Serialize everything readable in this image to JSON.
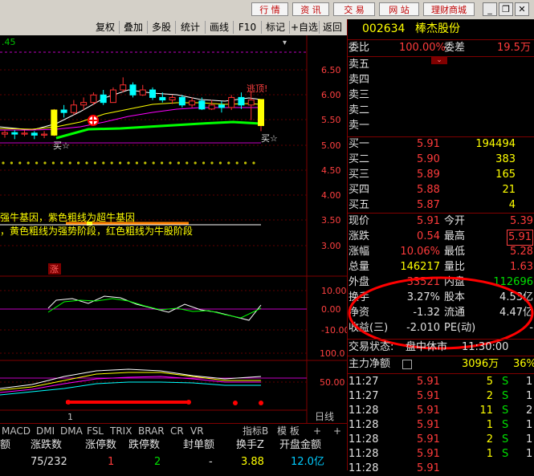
{
  "topbar": {
    "buttons": [
      "行 情",
      "资 讯",
      "交 易",
      "网 站",
      "理财商城"
    ]
  },
  "toolbar": {
    "items": [
      "复权",
      "叠加",
      "多股",
      "统计",
      "画线",
      "F10",
      "标记",
      "+自选",
      "返回"
    ],
    "price_label": ".45"
  },
  "chart": {
    "yaxis_main": [
      "6.50",
      "6.00",
      "5.50",
      "5.00",
      "4.50",
      "4.00",
      "3.50",
      "3.00"
    ],
    "yaxis_ind1": [
      "10.00",
      "0.00",
      "-10.00"
    ],
    "yaxis_ind2": [
      "100.0",
      "50.00"
    ],
    "annotation_top": "逃顶!",
    "buy_labels": [
      "买☆",
      "买☆"
    ],
    "text_line1": "强牛基因，紫色粗线为超牛基因",
    "text_line2": "，黄色粗线为强势阶段，红色粗线为牛股阶段",
    "zhang_badge": "涨",
    "x_label": "1",
    "period_label": "日线"
  },
  "chart_data": {
    "type": "candlestick",
    "ylim": [
      2.8,
      6.8
    ],
    "candles": [
      {
        "o": 5.22,
        "c": 5.25,
        "h": 5.3,
        "l": 5.15
      },
      {
        "o": 5.25,
        "c": 5.22,
        "h": 5.3,
        "l": 5.12
      },
      {
        "o": 5.22,
        "c": 5.24,
        "h": 5.3,
        "l": 5.18
      },
      {
        "o": 5.24,
        "c": 5.2,
        "h": 5.28,
        "l": 5.12
      },
      {
        "o": 5.2,
        "c": 5.22,
        "h": 5.28,
        "l": 5.14
      },
      {
        "o": 5.2,
        "c": 5.7,
        "h": 5.72,
        "l": 5.18
      },
      {
        "o": 5.7,
        "c": 5.65,
        "h": 5.8,
        "l": 5.55
      },
      {
        "o": 5.65,
        "c": 5.8,
        "h": 5.9,
        "l": 5.6
      },
      {
        "o": 5.8,
        "c": 5.85,
        "h": 5.95,
        "l": 5.7
      },
      {
        "o": 5.85,
        "c": 6.0,
        "h": 6.05,
        "l": 5.8
      },
      {
        "o": 6.0,
        "c": 5.85,
        "h": 6.1,
        "l": 5.8
      },
      {
        "o": 5.85,
        "c": 6.1,
        "h": 6.15,
        "l": 5.85
      },
      {
        "o": 6.1,
        "c": 6.2,
        "h": 6.35,
        "l": 6.05
      },
      {
        "o": 6.2,
        "c": 6.0,
        "h": 6.25,
        "l": 5.95
      },
      {
        "o": 6.0,
        "c": 6.1,
        "h": 6.2,
        "l": 5.98
      },
      {
        "o": 6.1,
        "c": 5.95,
        "h": 6.15,
        "l": 5.9
      },
      {
        "o": 5.95,
        "c": 5.9,
        "h": 6.05,
        "l": 5.85
      },
      {
        "o": 5.9,
        "c": 5.95,
        "h": 6.0,
        "l": 5.82
      },
      {
        "o": 5.95,
        "c": 5.8,
        "h": 6.0,
        "l": 5.75
      },
      {
        "o": 5.8,
        "c": 5.88,
        "h": 5.95,
        "l": 5.75
      },
      {
        "o": 5.88,
        "c": 5.72,
        "h": 5.95,
        "l": 5.7
      },
      {
        "o": 5.72,
        "c": 5.8,
        "h": 5.9,
        "l": 5.7
      },
      {
        "o": 5.8,
        "c": 5.75,
        "h": 5.88,
        "l": 5.65
      },
      {
        "o": 5.75,
        "c": 5.95,
        "h": 6.0,
        "l": 5.7
      },
      {
        "o": 5.95,
        "c": 5.8,
        "h": 6.05,
        "l": 5.72
      },
      {
        "o": 5.8,
        "c": 5.9,
        "h": 6.08,
        "l": 5.5
      },
      {
        "o": 5.39,
        "c": 5.91,
        "h": 5.91,
        "l": 5.28
      }
    ]
  },
  "bottom_tabs": [
    "MACD",
    "DMI",
    "DMA",
    "FSL",
    "TRIX",
    "BRAR",
    "CR",
    "VR",
    "指标B",
    "模 板",
    "+",
    "+"
  ],
  "stats": {
    "headers": [
      "额",
      "涨跌数",
      "涨停数",
      "跌停数",
      "封单额",
      "换手Z",
      "开盘金额"
    ],
    "values": [
      "",
      "75/232",
      "1",
      "2",
      "-",
      "3.88",
      "12.0亿"
    ]
  },
  "stock": {
    "code": "002634",
    "name": "棒杰股份",
    "weibi_label": "委比",
    "weibi": "100.00%",
    "weicha_label": "委差",
    "weicha": "19.5万",
    "sells": [
      {
        "label": "卖五"
      },
      {
        "label": "卖四"
      },
      {
        "label": "卖三"
      },
      {
        "label": "卖二"
      },
      {
        "label": "卖一"
      }
    ],
    "buys": [
      {
        "label": "买一",
        "price": "5.91",
        "vol": "194494"
      },
      {
        "label": "买二",
        "price": "5.90",
        "vol": "383"
      },
      {
        "label": "买三",
        "price": "5.89",
        "vol": "165"
      },
      {
        "label": "买四",
        "price": "5.88",
        "vol": "21"
      },
      {
        "label": "买五",
        "price": "5.87",
        "vol": "4"
      }
    ],
    "quote": [
      {
        "l1": "现价",
        "v1": "5.91",
        "l2": "今开",
        "v2": "5.39"
      },
      {
        "l1": "涨跌",
        "v1": "0.54",
        "l2": "最高",
        "v2": "5.91"
      },
      {
        "l1": "涨幅",
        "v1": "10.06%",
        "l2": "最低",
        "v2": "5.28"
      },
      {
        "l1": "总量",
        "v1": "146217",
        "l2": "量比",
        "v2": "1.63"
      },
      {
        "l1": "外盘",
        "v1": "33521",
        "l2": "内盘",
        "v2": "112696"
      },
      {
        "l1": "换手",
        "v1": "3.27%",
        "l2": "股本",
        "v2": "4.53亿"
      },
      {
        "l1": "净资",
        "v1": "-1.32",
        "l2": "流通",
        "v2": "4.47亿"
      },
      {
        "l1": "收益(三)",
        "v1": "-2.010",
        "l2": "PE(动)",
        "v2": "-"
      }
    ],
    "status_label": "交易状态:",
    "status_value": "盘中休市",
    "status_time": "11:30:00",
    "main_flow_label": "主力净额",
    "main_flow_value": "3096万",
    "main_flow_pct": "36%",
    "ticks": [
      {
        "t": "11:27",
        "p": "5.91",
        "v": "5",
        "s": "S",
        "n": "1"
      },
      {
        "t": "11:27",
        "p": "5.91",
        "v": "2",
        "s": "S",
        "n": "1"
      },
      {
        "t": "11:28",
        "p": "5.91",
        "v": "11",
        "s": "S",
        "n": "2"
      },
      {
        "t": "11:28",
        "p": "5.91",
        "v": "1",
        "s": "S",
        "n": "1"
      },
      {
        "t": "11:28",
        "p": "5.91",
        "v": "2",
        "s": "S",
        "n": "1"
      },
      {
        "t": "11:28",
        "p": "5.91",
        "v": "1",
        "s": "S",
        "n": "1"
      },
      {
        "t": "11:28",
        "p": "5.91",
        "v": "",
        "s": "",
        "n": ""
      }
    ]
  }
}
